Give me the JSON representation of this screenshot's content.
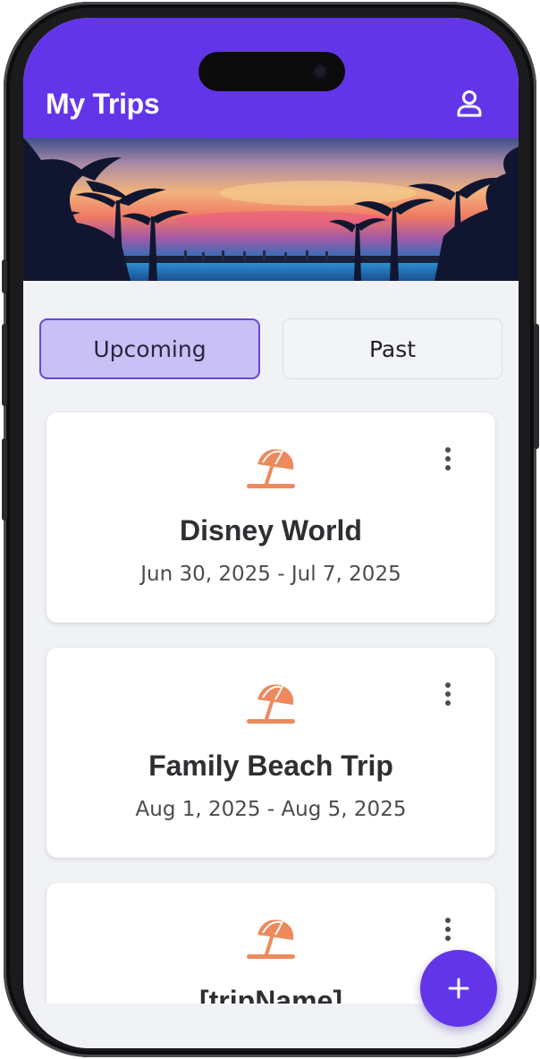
{
  "app": {
    "title": "My Trips"
  },
  "tabs": [
    {
      "label": "Upcoming",
      "selected": true
    },
    {
      "label": "Past",
      "selected": false
    }
  ],
  "trips": [
    {
      "name": "Disney World",
      "dates": "Jun 30, 2025 - Jul 7, 2025",
      "icon": "beach-umbrella-icon"
    },
    {
      "name": "Family Beach Trip",
      "dates": "Aug 1, 2025 - Aug 5, 2025",
      "icon": "beach-umbrella-icon"
    },
    {
      "name": "[tripName]",
      "dates": "",
      "icon": "beach-umbrella-icon"
    }
  ],
  "icons": {
    "profile": "user-icon",
    "more": "more-vertical-icon",
    "add": "plus-icon"
  },
  "colors": {
    "primary": "#6236e8",
    "tab_selected_bg": "#c9c0f5",
    "trip_icon": "#ec8a5c",
    "background": "#f0f2f5"
  }
}
